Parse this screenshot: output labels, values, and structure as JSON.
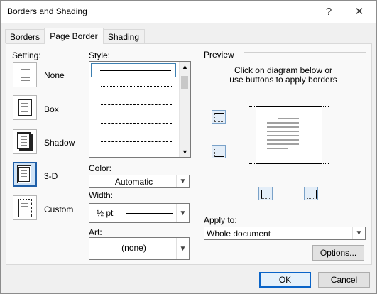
{
  "window": {
    "title": "Borders and Shading",
    "help_glyph": "?",
    "close_glyph": "✕"
  },
  "tabs": [
    {
      "label": "Borders",
      "active": false
    },
    {
      "label": "Page Border",
      "active": true
    },
    {
      "label": "Shading",
      "active": false
    }
  ],
  "setting": {
    "heading": "Setting:",
    "items": [
      {
        "label": "None",
        "icon": "none-setting-icon",
        "selected": false
      },
      {
        "label": "Box",
        "icon": "box-setting-icon",
        "selected": false
      },
      {
        "label": "Shadow",
        "icon": "shadow-setting-icon",
        "selected": false
      },
      {
        "label": "3-D",
        "icon": "3d-setting-icon",
        "selected": true
      },
      {
        "label": "Custom",
        "icon": "custom-setting-icon",
        "selected": false
      }
    ]
  },
  "style": {
    "heading": "Style:",
    "options": [
      "solid",
      "dotted-fine",
      "dashed-small",
      "dashed-medium",
      "dash-dot"
    ],
    "selected": "solid"
  },
  "color": {
    "label": "Color:",
    "value": "Automatic"
  },
  "width": {
    "label": "Width:",
    "value": "½ pt"
  },
  "art": {
    "label": "Art:",
    "value": "(none)"
  },
  "preview": {
    "heading": "Preview",
    "instruction_line1": "Click on diagram below or",
    "instruction_line2": "use buttons to apply borders"
  },
  "apply_to": {
    "label": "Apply to:",
    "value": "Whole document"
  },
  "buttons": {
    "options": "Options...",
    "ok": "OK",
    "cancel": "Cancel"
  },
  "colors": {
    "accent": "#0a64c8",
    "selection": "#cfe3f7"
  }
}
